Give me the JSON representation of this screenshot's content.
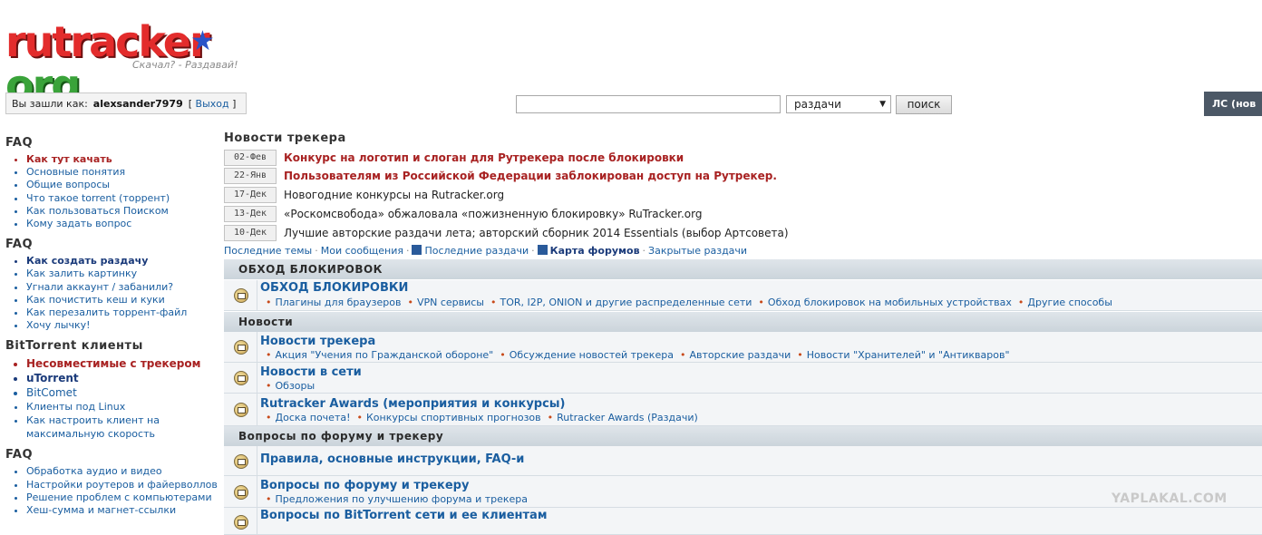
{
  "logo": {
    "main": "rutracker",
    "star": "★",
    "org": "org",
    "slogan": "Скачал? - Раздавай!"
  },
  "login": {
    "prefix": "Вы зашли как:",
    "username": "alexsander7979",
    "logout": "Выход"
  },
  "search": {
    "value": "",
    "select": "раздачи",
    "button": "поиск"
  },
  "pm": {
    "label": "ЛС (нов"
  },
  "sidebar": {
    "sections": [
      {
        "title": "FAQ",
        "items": [
          {
            "label": "Как тут качать",
            "style": "red"
          },
          {
            "label": "Основные понятия"
          },
          {
            "label": "Общие вопросы"
          },
          {
            "label": "Что такое torrent (торрент)"
          },
          {
            "label": "Как пользоваться Поиском"
          },
          {
            "label": "Кому задать вопрос"
          }
        ]
      },
      {
        "title": "FAQ",
        "items": [
          {
            "label": "Как создать раздачу",
            "style": "navy"
          },
          {
            "label": "Как залить картинку"
          },
          {
            "label": "Угнали аккаунт / забанили?"
          },
          {
            "label": "Как почистить кеш и куки"
          },
          {
            "label": "Как перезалить торрент-файл"
          },
          {
            "label": "Хочу лычку!"
          }
        ]
      },
      {
        "title": "BitTorrent клиенты",
        "items": [
          {
            "label": "Несовместимые с трекером",
            "style": "red"
          },
          {
            "label": "uTorrent",
            "style": "navy"
          },
          {
            "label": "BitComet"
          },
          {
            "label": "Клиенты под Linux",
            "style": "sm"
          },
          {
            "label": "Как настроить клиент на максимальную скорость",
            "style": "sm"
          }
        ]
      },
      {
        "title": "FAQ",
        "items": [
          {
            "label": "Обработка аудио и видео"
          },
          {
            "label": "Настройки роутеров и файерволлов"
          },
          {
            "label": "Решение проблем с компьютерами"
          },
          {
            "label": "Хеш-сумма и магнет-ссылки"
          }
        ]
      }
    ]
  },
  "news": {
    "title": "Новости трекера",
    "items": [
      {
        "date": "02-Фев",
        "text": "Конкурс на логотип и слоган для Рутрекера после блокировки",
        "hl": true
      },
      {
        "date": "22-Янв",
        "text": "Пользователям из Российской Федерации заблокирован доступ на Рутрекер.",
        "hl": true
      },
      {
        "date": "17-Дек",
        "text": "Новогодние конкурсы на Rutracker.org",
        "hl": false
      },
      {
        "date": "13-Дек",
        "text": "«Роскомсвобода» обжаловала «пожизненную блокировку» RuTracker.org",
        "hl": false
      },
      {
        "date": "10-Дек",
        "text": "Лучшие авторские раздачи лета; авторский сборник 2014 Essentials (выбор Артсовета)",
        "hl": false
      }
    ]
  },
  "quicklinks": {
    "latest_topics": "Последние темы",
    "my_posts": "Мои сообщения",
    "latest_releases": "Последние раздачи",
    "forum_map": "Карта форумов",
    "closed_releases": "Закрытые раздачи"
  },
  "forum": {
    "categories": [
      {
        "name": "ОБХОД БЛОКИРОВОК",
        "forums": [
          {
            "title": "ОБХОД БЛОКИРОВКИ",
            "subs": [
              "Плагины для браузеров",
              "VPN сервисы",
              "TOR, I2P, ONION и другие распределенные сети",
              "Обход блокировок на мобильных устройствах",
              "Другие способы"
            ]
          }
        ]
      },
      {
        "name": "Новости",
        "forums": [
          {
            "title": "Новости трекера",
            "subs": [
              "Акция \"Учения по Гражданской обороне\"",
              "Обсуждение новостей трекера",
              "Авторские раздачи",
              "Новости \"Хранителей\" и \"Антикваров\""
            ]
          },
          {
            "title": "Новости в сети",
            "subs": [
              "Обзоры"
            ]
          },
          {
            "title": "Rutracker Awards (мероприятия и конкурсы)",
            "subs": [
              "Доска почета!",
              "Конкурсы спортивных прогнозов",
              "Rutracker Awards (Раздачи)"
            ]
          }
        ]
      },
      {
        "name": "Вопросы по форуму и трекеру",
        "forums": [
          {
            "title": "Правила, основные инструкции, FAQ-и",
            "subs": []
          },
          {
            "title": "Вопросы по форуму и трекеру",
            "subs": [
              "Предложения по улучшению форума и трекера"
            ]
          },
          {
            "title": "Вопросы по BitTorrent сети и ее клиентам",
            "subs": []
          }
        ]
      }
    ]
  },
  "watermark": "YAPLAKAL.COM"
}
